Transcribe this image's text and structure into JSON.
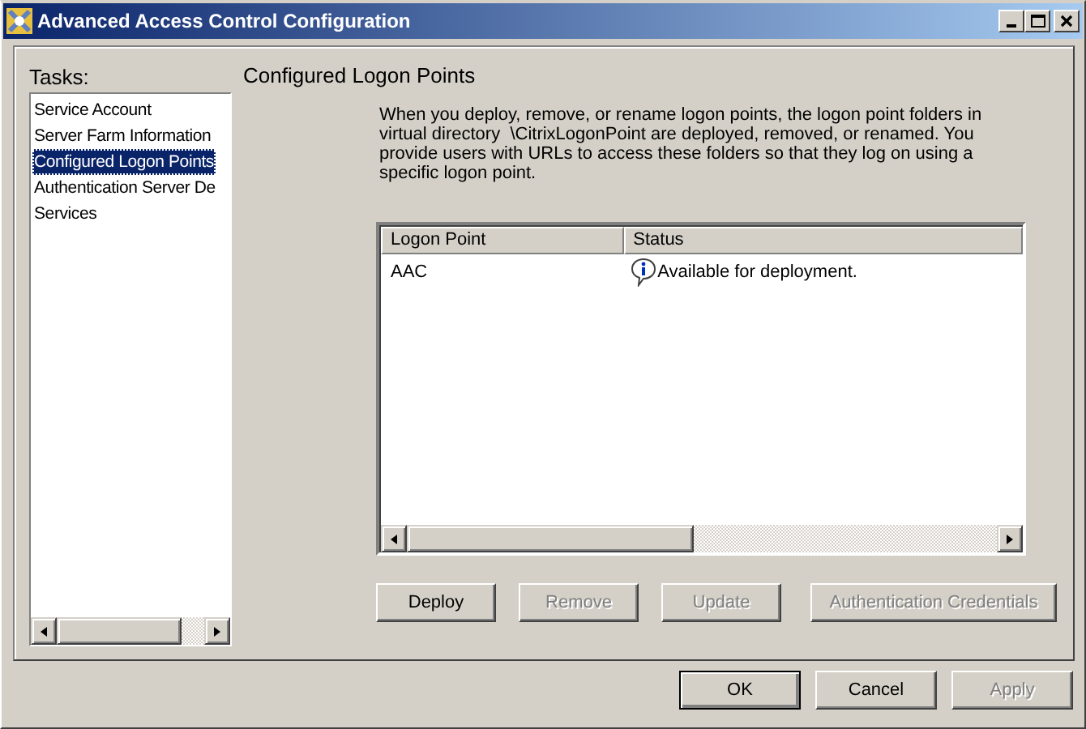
{
  "window": {
    "title": "Advanced Access Control Configuration"
  },
  "tasks": {
    "label": "Tasks:",
    "items": [
      {
        "label": "Service Account",
        "selected": false
      },
      {
        "label": "Server Farm Information",
        "selected": false
      },
      {
        "label": "Configured Logon Points",
        "selected": true
      },
      {
        "label": "Authentication Server De",
        "selected": false
      },
      {
        "label": "Services",
        "selected": false
      }
    ]
  },
  "page": {
    "heading": "Configured Logon Points",
    "description": "When you deploy, remove, or rename logon points, the logon point folders in virtual directory  \\CitrixLogonPoint are deployed, removed, or renamed. You provide users with URLs to access these folders so that they log on using a specific logon point."
  },
  "table": {
    "columns": [
      "Logon Point",
      "Status"
    ],
    "rows": [
      {
        "logon_point": "AAC",
        "status": "Available for deployment."
      }
    ]
  },
  "actions": [
    {
      "label": "Deploy",
      "disabled": false
    },
    {
      "label": "Remove",
      "disabled": true
    },
    {
      "label": "Update",
      "disabled": true
    },
    {
      "label": "Authentication Credentials",
      "disabled": true
    }
  ],
  "buttons": [
    {
      "label": "OK",
      "disabled": false,
      "default": true
    },
    {
      "label": "Cancel",
      "disabled": false,
      "default": false
    },
    {
      "label": "Apply",
      "disabled": true,
      "default": false
    }
  ]
}
